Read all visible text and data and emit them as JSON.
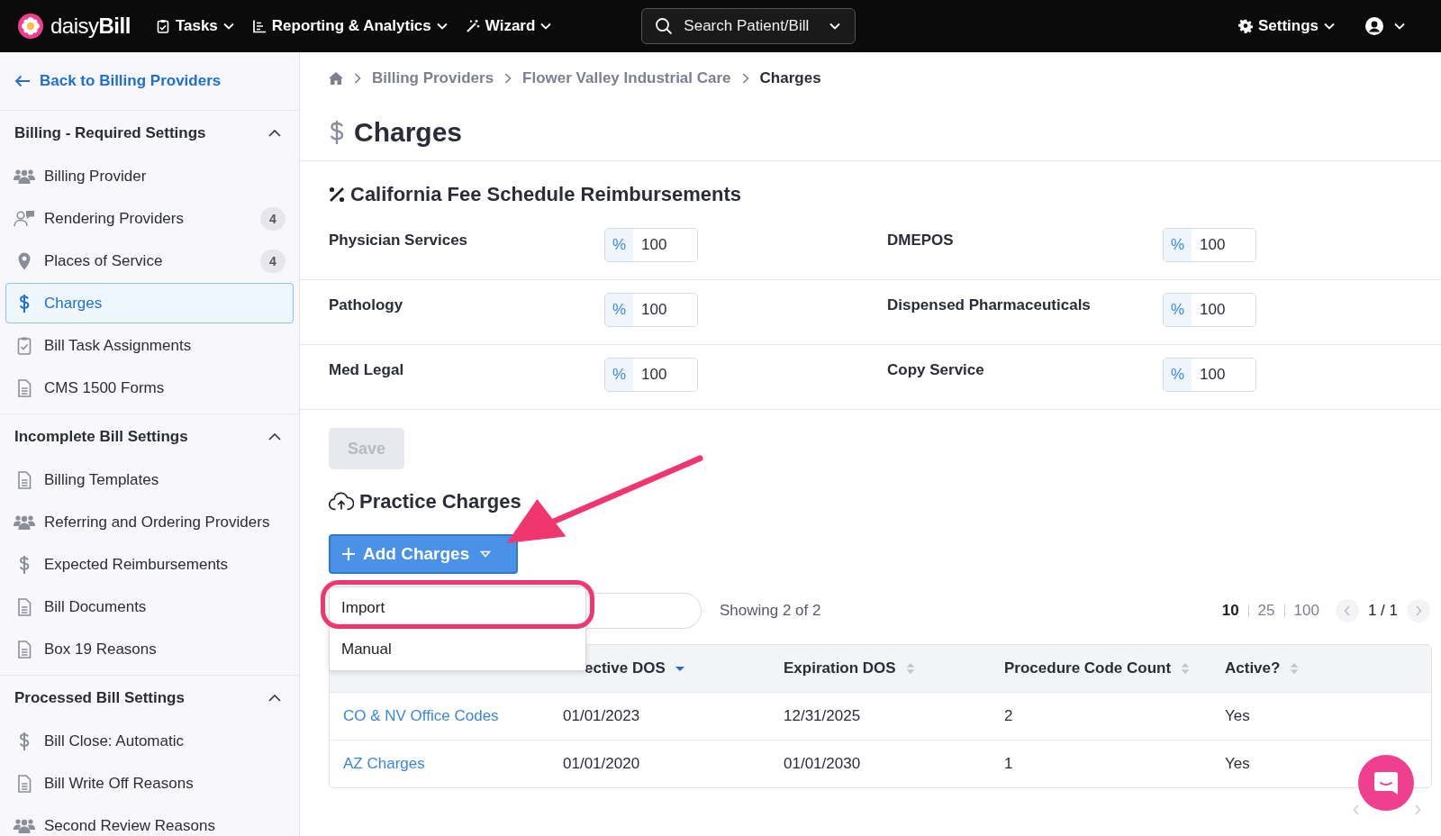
{
  "topbar": {
    "logo": "daisy**Bill**",
    "menus": [
      {
        "label": "Tasks",
        "kind": "clipboard"
      },
      {
        "label": "Reporting & Analytics",
        "kind": "chart"
      },
      {
        "label": "Wizard",
        "kind": "wand"
      }
    ],
    "search": {
      "placeholder": "Search Patient/Bill"
    },
    "settings": "Settings"
  },
  "sidebar": {
    "back": "Back to Billing Providers",
    "sections": [
      {
        "title": "Billing - Required Settings",
        "expanded": true,
        "items": [
          {
            "label": "Billing Provider",
            "kind": "people",
            "selected": false
          },
          {
            "label": "Rendering Providers",
            "kind": "people-chat",
            "badge": "4",
            "selected": false
          },
          {
            "label": "Places of Service",
            "kind": "pin",
            "badge": "4",
            "selected": false
          },
          {
            "label": "Charges",
            "kind": "dollar",
            "selected": true
          },
          {
            "label": "Bill Task Assignments",
            "kind": "clipboard",
            "selected": false
          },
          {
            "label": "CMS 1500 Forms",
            "kind": "document",
            "selected": false
          }
        ]
      },
      {
        "title": "Incomplete Bill Settings",
        "expanded": true,
        "items": [
          {
            "label": "Billing Templates",
            "kind": "document",
            "selected": false
          },
          {
            "label": "Referring and Ordering Providers",
            "kind": "people",
            "selected": false
          },
          {
            "label": "Expected Reimbursements",
            "kind": "dollar",
            "selected": false
          },
          {
            "label": "Bill Documents",
            "kind": "document",
            "selected": false
          },
          {
            "label": "Box 19 Reasons",
            "kind": "document",
            "selected": false
          }
        ]
      },
      {
        "title": "Processed Bill Settings",
        "expanded": true,
        "items": [
          {
            "label": "Bill Close: Automatic",
            "kind": "dollar",
            "selected": false
          },
          {
            "label": "Bill Write Off Reasons",
            "kind": "document",
            "selected": false
          },
          {
            "label": "Second Review Reasons",
            "kind": "people",
            "selected": false
          }
        ]
      }
    ]
  },
  "breadcrumb": [
    "Billing Providers",
    "Flower Valley Industrial Care",
    "Charges"
  ],
  "page_title": "Charges",
  "fee_schedule": {
    "title": "California Fee Schedule Reimbursements",
    "fields": [
      {
        "label": "Physician Services",
        "unit": "%",
        "value": "100"
      },
      {
        "label": "DMEPOS",
        "unit": "%",
        "value": "100"
      },
      {
        "label": "Pathology",
        "unit": "%",
        "value": "100"
      },
      {
        "label": "Dispensed Pharmaceuticals",
        "unit": "%",
        "value": "100"
      },
      {
        "label": "Med Legal",
        "unit": "%",
        "value": "100"
      },
      {
        "label": "Copy Service",
        "unit": "%",
        "value": "100"
      }
    ],
    "save": {
      "label": "Save",
      "disabled": true
    }
  },
  "practice_charges": {
    "title": "Practice Charges",
    "add_button": "Add Charges",
    "menu": [
      {
        "label": "Import",
        "highlighted": true
      },
      {
        "label": "Manual",
        "highlighted": false
      }
    ],
    "showing": "Showing 2 of 2",
    "page_sizes": [
      {
        "label": "10",
        "selected": true
      },
      {
        "label": "25",
        "selected": false
      },
      {
        "label": "100",
        "selected": false
      }
    ],
    "page": "1 / 1",
    "table": {
      "columns": [
        {},
        {
          "label": "ective DOS",
          "sorted": true
        },
        {
          "label": "Expiration DOS",
          "sorted": false
        },
        {
          "label": "Procedure Code Count",
          "sorted": false
        },
        {
          "label": "Active?",
          "sorted": false
        }
      ],
      "rows": [
        [
          "CO & NV Office Codes",
          "01/01/2023",
          "12/31/2025",
          "2",
          "Yes"
        ],
        [
          "AZ Charges",
          "01/01/2020",
          "01/01/2030",
          "1",
          "Yes"
        ]
      ]
    }
  }
}
